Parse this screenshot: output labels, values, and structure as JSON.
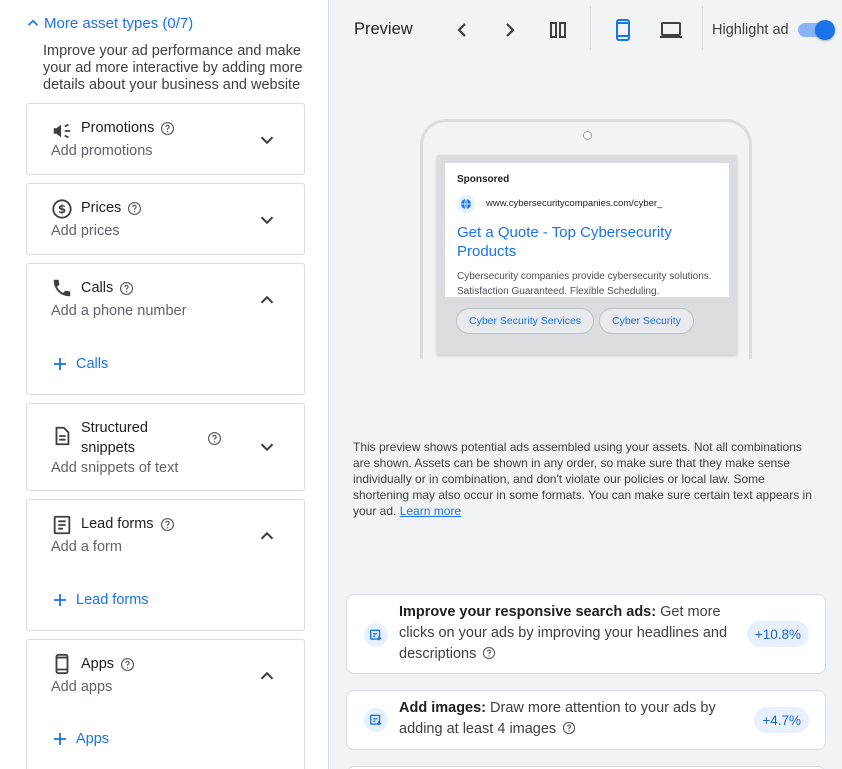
{
  "left": {
    "more_toggle": "More asset types (0/7)",
    "intro": "Improve your ad performance and make your ad more interactive by adding more details about your business and website",
    "cards": [
      {
        "title": "Promotions",
        "sub": "Add promotions",
        "icon": "megaphone-icon"
      },
      {
        "title": "Prices",
        "sub": "Add prices",
        "icon": "dollar-circle-icon"
      },
      {
        "title": "Calls",
        "sub": "Add a phone number",
        "icon": "phone-icon",
        "add_label": "Calls"
      },
      {
        "title": "Structured snippets",
        "sub": "Add snippets of text",
        "icon": "snippet-icon"
      },
      {
        "title": "Lead forms",
        "sub": "Add a form",
        "icon": "form-icon",
        "add_label": "Lead forms"
      },
      {
        "title": "Apps",
        "sub": "Add apps",
        "icon": "mobile-icon",
        "add_label": "Apps"
      }
    ]
  },
  "right": {
    "preview_label": "Preview",
    "highlight_label": "Highlight ad",
    "ad": {
      "sponsored": "Sponsored",
      "url": "www.cybersecuritycompanies.com/cyber_",
      "headline": "Get a Quote - Top Cybersecurity Products",
      "description": "Cybersecurity companies provide cybersecurity solutions. Satisfaction Guaranteed. Flexible Scheduling.",
      "sitelinks": [
        "Cyber Security Services",
        "Cyber Security"
      ]
    },
    "disclaimer": "This preview shows potential ads assembled using your assets. Not all combinations are shown. Assets can be shown in any order, so make sure that they make sense individually or in combination, and don't violate our policies or local law. Some shortening may also occur in some formats. You can make sure certain text appears in your ad.",
    "learn_more": "Learn more",
    "recommendations": [
      {
        "bold": "Improve your responsive search ads:",
        "text": " Get more clicks on your ads by improving your headlines and descriptions",
        "badge": "+10.8%"
      },
      {
        "bold": "Add images:",
        "text": " Draw more attention to your ads by adding at least 4 images",
        "badge": "+4.7%"
      }
    ]
  },
  "colors": {
    "accent": "#1a73e8",
    "panel_bg": "#f1f3f4",
    "border": "#dadce0"
  }
}
